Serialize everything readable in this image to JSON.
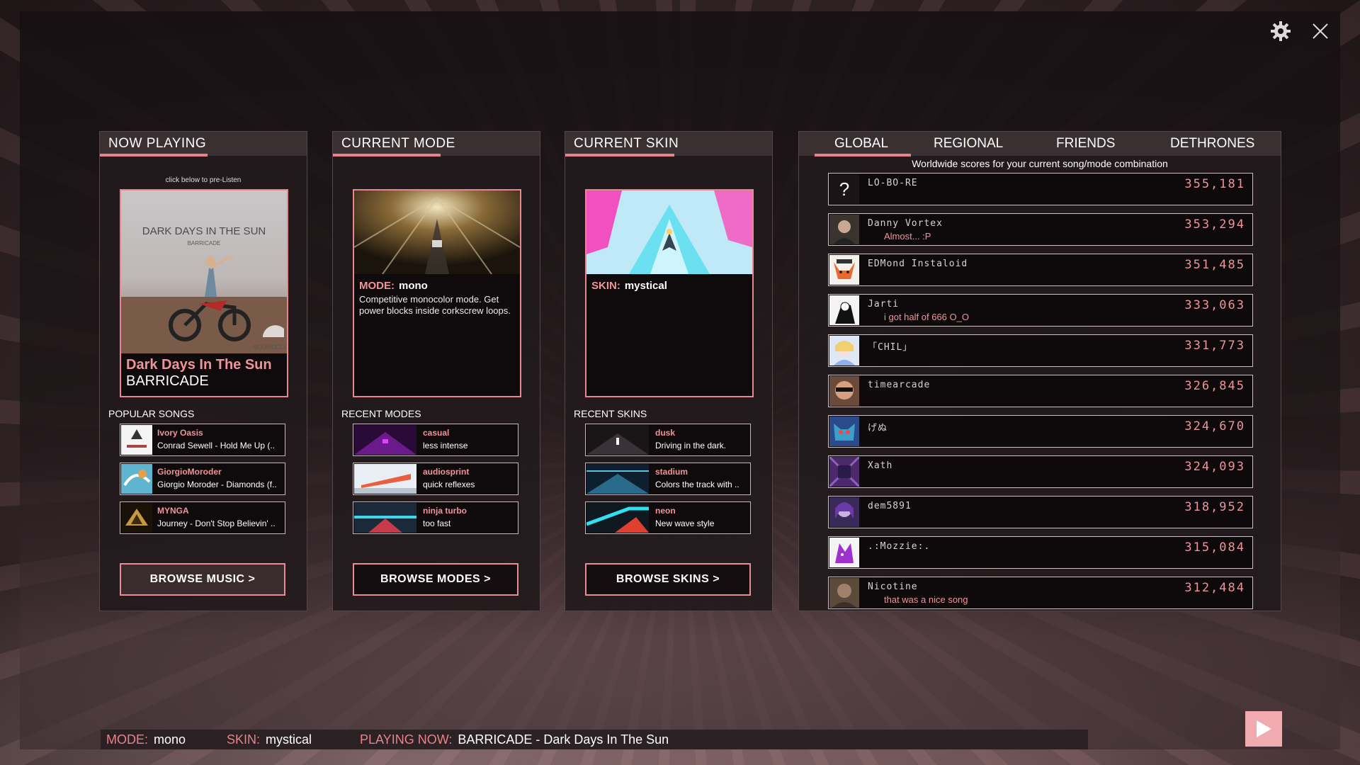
{
  "window_icons": {
    "settings": "gear-icon",
    "close": "close-icon"
  },
  "now_playing": {
    "title": "NOW PLAYING",
    "hint": "click below to pre-Listen",
    "cover_text": "DARK DAYS IN THE SUN",
    "cover_artist": "BARRICADE",
    "cover_watermark": "SOUNDCLOUD",
    "song_title": "Dark Days In The Sun",
    "song_artist": "BARRICADE",
    "section_label": "POPULAR SONGS",
    "items": [
      {
        "title": "Ivory Oasis",
        "sub": "Conrad Sewell - Hold Me Up (.."
      },
      {
        "title": "GiorgioMoroder",
        "sub": "Giorgio Moroder - Diamonds (f.."
      },
      {
        "title": "MYNGA",
        "sub": "Journey - Don't Stop Believin' .."
      }
    ],
    "button": "BROWSE MUSIC >"
  },
  "current_mode": {
    "title": "CURRENT MODE",
    "label_key": "MODE:",
    "label_value": "mono",
    "description": "Competitive monocolor mode. Get power blocks inside corkscrew loops.",
    "section_label": "RECENT MODES",
    "items": [
      {
        "title": "casual",
        "sub": "less intense"
      },
      {
        "title": "audiosprint",
        "sub": "quick reflexes"
      },
      {
        "title": "ninja turbo",
        "sub": "too fast"
      }
    ],
    "button": "BROWSE MODES >"
  },
  "current_skin": {
    "title": "CURRENT SKIN",
    "label_key": "SKIN:",
    "label_value": "mystical",
    "section_label": "RECENT SKINS",
    "items": [
      {
        "title": "dusk",
        "sub": "Driving in the dark."
      },
      {
        "title": "stadium",
        "sub": "Colors the track with .."
      },
      {
        "title": "neon",
        "sub": "New wave style"
      }
    ],
    "button": "BROWSE SKINS >"
  },
  "leaderboard": {
    "tabs": [
      "GLOBAL",
      "REGIONAL",
      "FRIENDS",
      "DETHRONES"
    ],
    "active_tab": "GLOBAL",
    "subtitle": "Worldwide scores for your current song/mode combination",
    "entries": [
      {
        "name": "LO-BO-RE",
        "message": "",
        "score": "355,181",
        "avatar": "question-mark"
      },
      {
        "name": "Danny Vortex",
        "message": "Almost... :P",
        "score": "353,294",
        "avatar": "photo"
      },
      {
        "name": "EDMond Instaloid",
        "message": "",
        "score": "351,485",
        "avatar": "fox"
      },
      {
        "name": "Jarti",
        "message": "i got half of 666 O_O",
        "score": "333,063",
        "avatar": "character"
      },
      {
        "name": "「CHIL」",
        "message": "",
        "score": "331,773",
        "avatar": "anime"
      },
      {
        "name": "timearcade",
        "message": "",
        "score": "326,845",
        "avatar": "photo"
      },
      {
        "name": "げぬ",
        "message": "",
        "score": "324,670",
        "avatar": "monster"
      },
      {
        "name": "Xath",
        "message": "",
        "score": "324,093",
        "avatar": "abstract"
      },
      {
        "name": "dem5891",
        "message": "",
        "score": "318,952",
        "avatar": "anime"
      },
      {
        "name": ".:Mozzie:.",
        "message": "",
        "score": "315,084",
        "avatar": "purple-fox"
      },
      {
        "name": "Nicotine",
        "message": "that was a nice song",
        "score": "312,484",
        "avatar": "photo"
      }
    ]
  },
  "status": {
    "mode_key": "MODE:",
    "mode_value": "mono",
    "skin_key": "SKIN:",
    "skin_value": "mystical",
    "playing_key": "PLAYING NOW:",
    "playing_value": "BARRICADE - Dark Days In The Sun"
  },
  "colors": {
    "accent": "#e6838c",
    "play_button": "#f0aab0"
  }
}
